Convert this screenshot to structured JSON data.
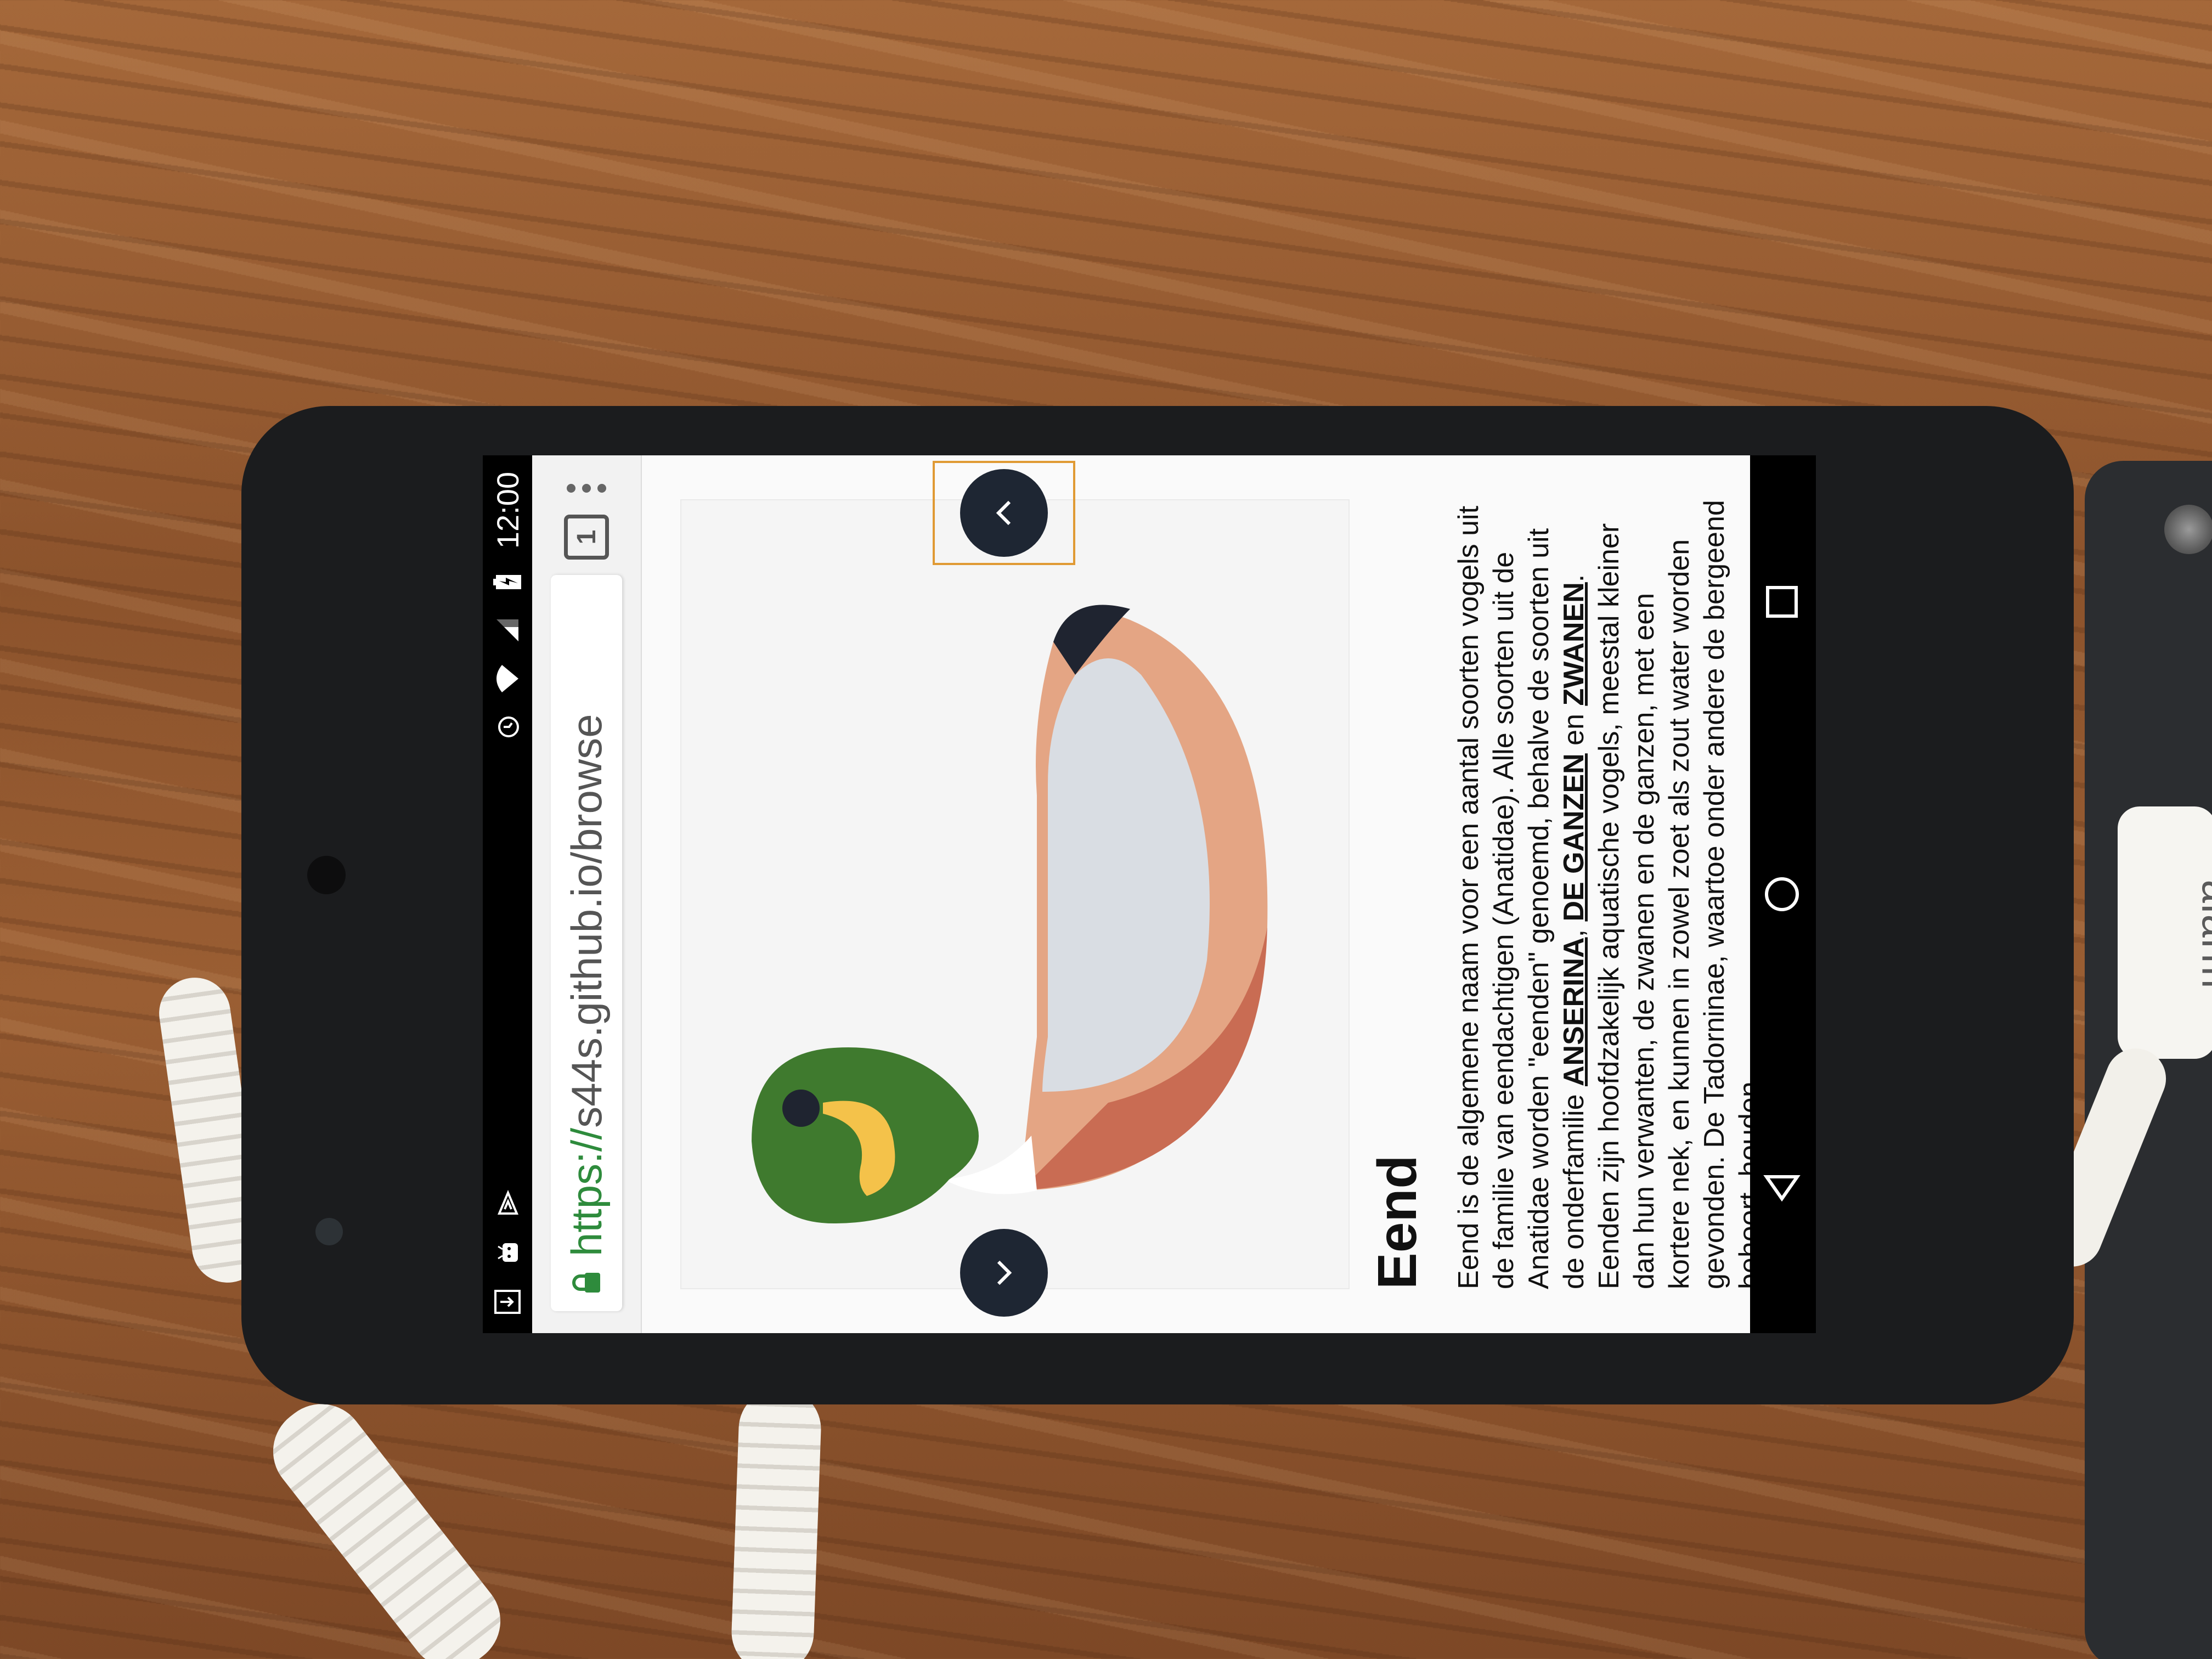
{
  "status_bar": {
    "time": "12:00",
    "icons": [
      "download-icon",
      "android-icon",
      "notification-icon",
      "alarm-clock-icon",
      "wifi-icon",
      "signal-icon",
      "battery-charging-icon"
    ]
  },
  "browser": {
    "url_scheme": "https://",
    "url_rest": "s44s.github.io/browse",
    "tab_count": "1"
  },
  "article": {
    "title": "Eend",
    "p1_a": "Eend is de algemene naam voor een aantal soorten vogels uit de familie van eendachtigen (Anatidae). Alle soorten uit de Anatidae worden \"eenden\" genoemd, behalve de soorten uit de onderfamilie ",
    "link1": "ANSERINA",
    "sep1": ", ",
    "link2": "DE GANZEN",
    "sep2": " en ",
    "link3": "ZWANEN",
    "p1_end": ".",
    "p2": "Eenden zijn hoofdzakelijk aquatische vogels, meestal kleiner dan hun verwanten, de zwanen en de ganzen, met een kortere nek, en kunnen in zowel zoet als zout water worden gevonden. De Tadorninae, waartoe onder andere de bergeend behoort, houden"
  },
  "alarm_tag": {
    "label": "alarm"
  },
  "colors": {
    "duck_head": "#3f7a2e",
    "duck_beak": "#f4c24a",
    "duck_body": "#e4a584",
    "duck_breast": "#c96c53",
    "duck_wing": "#d9dde3",
    "duck_tail": "#1f2430",
    "arrow_bg": "#1e2633",
    "url_green": "#2e8b3c"
  }
}
